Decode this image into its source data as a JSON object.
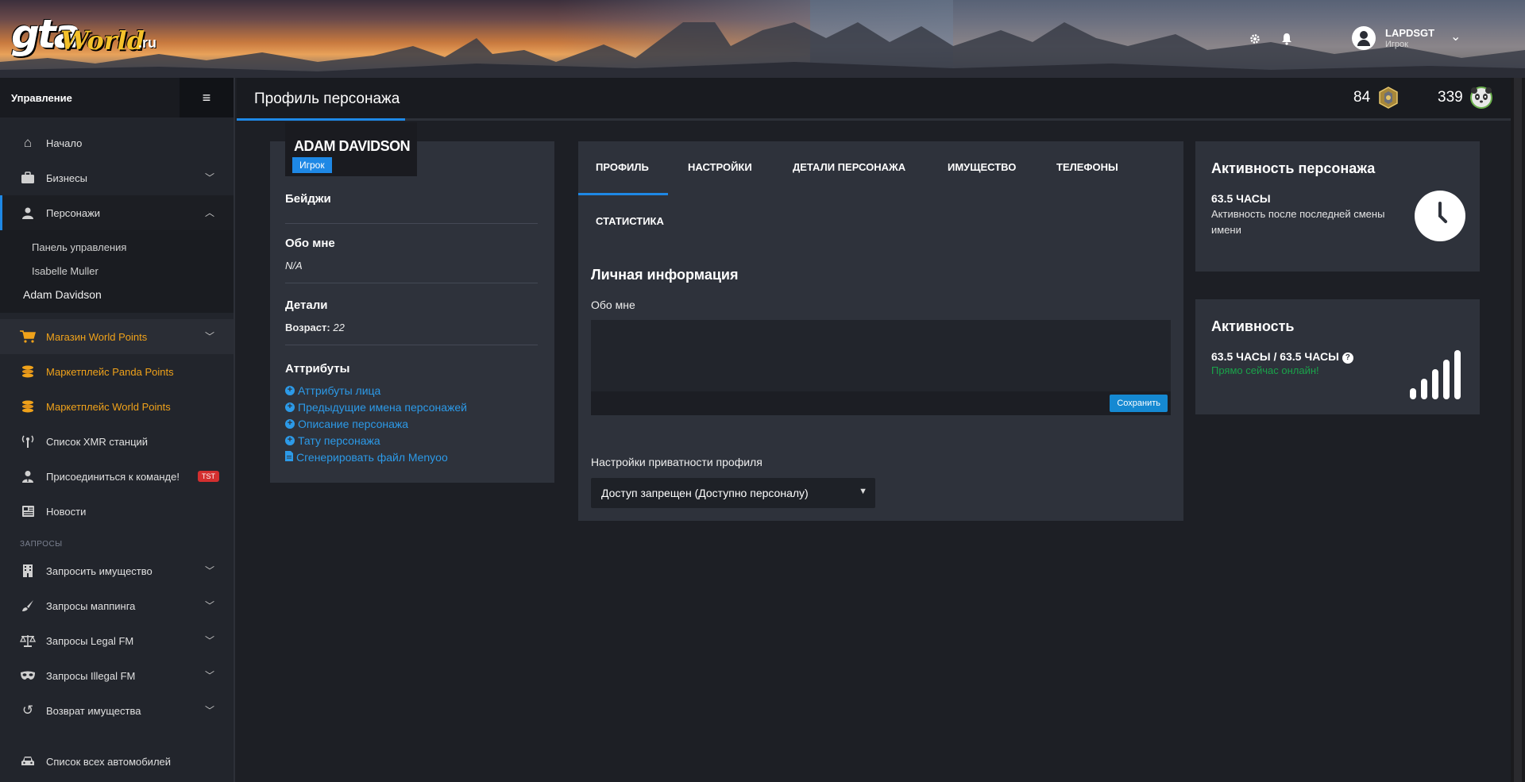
{
  "header": {
    "logo": {
      "gta": "gta",
      "world": "World",
      "ru": ".ru"
    },
    "icons": [
      "gear-icon",
      "bell-icon"
    ],
    "user": {
      "name": "LAPDSGT",
      "role": "Игрок"
    }
  },
  "sidebar": {
    "title": "Управление",
    "items": [
      {
        "label": "Начало",
        "icon": "home-icon"
      },
      {
        "label": "Бизнесы",
        "icon": "briefcase-icon"
      },
      {
        "label": "Персонажи",
        "icon": "person-icon"
      }
    ],
    "characters_sub": [
      "Панель управления",
      "Isabelle Muller",
      "Adam Davidson"
    ],
    "items2": [
      {
        "label": "Магазин World Points",
        "icon": "cart-icon"
      },
      {
        "label": "Маркетплейс Panda Points",
        "icon": "coins-icon"
      },
      {
        "label": "Маркетплейс World Points",
        "icon": "coins-icon"
      },
      {
        "label": "Список XMR станций",
        "icon": "antenna-icon"
      },
      {
        "label": "Присоединиться к команде!",
        "icon": "user-tie-icon",
        "badge": "TST"
      },
      {
        "label": "Новости",
        "icon": "newspaper-icon"
      }
    ],
    "section": "ЗАПРОСЫ",
    "requests": [
      {
        "label": "Запросить имущество",
        "icon": "building-icon"
      },
      {
        "label": "Запросы маппинга",
        "icon": "brush-icon"
      },
      {
        "label": "Запросы Legal FM",
        "icon": "scale-icon"
      },
      {
        "label": "Запросы Illegal FM",
        "icon": "mask-icon"
      },
      {
        "label": "Возврат имущества",
        "icon": "undo-icon"
      }
    ],
    "bottom": {
      "label": "Список всех автомобилей",
      "icon": "car-icon"
    }
  },
  "titlebar": {
    "title": "Профиль персонажа",
    "points": [
      {
        "value": "84",
        "icon": "rank-badge-icon"
      },
      {
        "value": "339",
        "icon": "panda-icon"
      }
    ]
  },
  "profile": {
    "name": "ADAM DAVIDSON",
    "role": "Игрок",
    "badges_title": "Бейджи",
    "about_title": "Обо мне",
    "about_value": "N/A",
    "details_title": "Детали",
    "age_label": "Возраст:",
    "age_value": "22",
    "attributes_title": "Аттрибуты",
    "attributes": [
      "Аттрибуты лица",
      "Предыдущие имена персонажей",
      "Описание персонажа",
      "Тату персонажа",
      "Сгенерировать файл Menyoo"
    ]
  },
  "tabs": [
    "ПРОФИЛЬ",
    "НАСТРОЙКИ",
    "ДЕТАЛИ ПЕРСОНАЖА",
    "ИМУЩЕСТВО",
    "ТЕЛЕФОНЫ",
    "СТАТИСТИКА"
  ],
  "personal": {
    "heading": "Личная информация",
    "about_label": "Обо мне",
    "save_label": "Сохранить",
    "privacy_label": "Настройки приватности профиля",
    "privacy_value": "Доступ запрещен (Доступно персоналу)"
  },
  "activity_char": {
    "title": "Активность персонажа",
    "hours": "63.5 ЧАСЫ",
    "desc": "Активность после последней смены имени"
  },
  "activity": {
    "title": "Активность",
    "hours": "63.5 ЧАСЫ / 63.5 ЧАСЫ",
    "status": "Прямо сейчас онлайн!"
  }
}
